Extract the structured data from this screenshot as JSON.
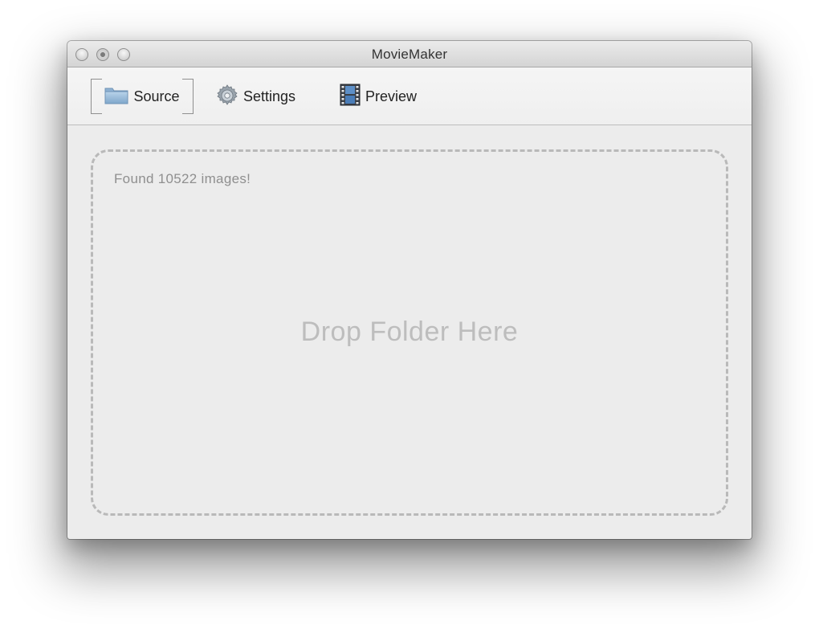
{
  "window": {
    "title": "MovieMaker"
  },
  "toolbar": {
    "items": [
      {
        "label": "Source",
        "icon": "folder-icon",
        "selected": true
      },
      {
        "label": "Settings",
        "icon": "gear-icon",
        "selected": false
      },
      {
        "label": "Preview",
        "icon": "film-icon",
        "selected": false
      }
    ]
  },
  "dropzone": {
    "status": "Found 10522 images!",
    "prompt": "Drop Folder Here"
  },
  "colors": {
    "window_background": "#ececec",
    "dashed_border": "#b9b9b9",
    "status_text": "#8f8f8f",
    "prompt_text": "#bdbdbd"
  }
}
